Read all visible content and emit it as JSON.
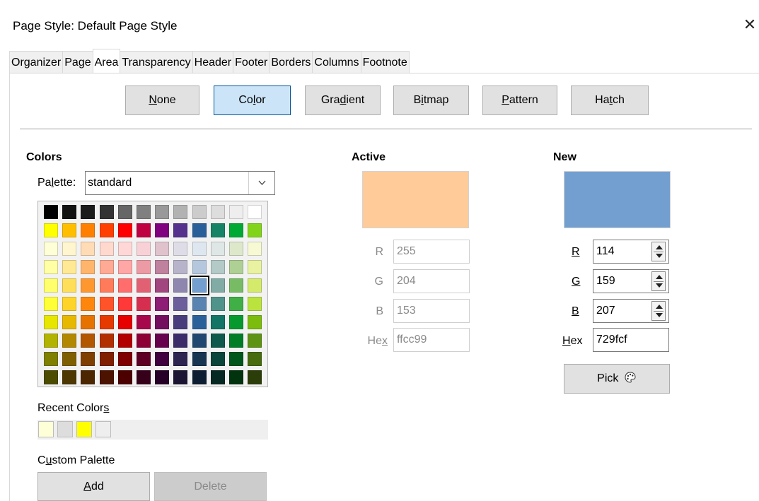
{
  "window": {
    "title": "Page Style: Default Page Style",
    "close_glyph": "✕"
  },
  "tabs": [
    {
      "label": "Organizer",
      "active": false
    },
    {
      "label": "Page",
      "active": false
    },
    {
      "label": "Area",
      "active": true
    },
    {
      "label": "Transparency",
      "active": false
    },
    {
      "label": "Header",
      "active": false
    },
    {
      "label": "Footer",
      "active": false
    },
    {
      "label": "Borders",
      "active": false
    },
    {
      "label": "Columns",
      "active": false
    },
    {
      "label": "Footnote",
      "active": false
    }
  ],
  "modes": {
    "none": {
      "pre": "",
      "key": "N",
      "post": "one"
    },
    "color": {
      "pre": "Co",
      "key": "l",
      "post": "or"
    },
    "gradient": {
      "pre": "Gra",
      "key": "d",
      "post": "ient"
    },
    "bitmap": {
      "pre": "B",
      "key": "i",
      "post": "tmap"
    },
    "pattern": {
      "pre": "",
      "key": "P",
      "post": "attern"
    },
    "hatch": {
      "pre": "Ha",
      "key": "t",
      "post": "ch"
    },
    "active": "color"
  },
  "colors": {
    "heading": "Colors",
    "palette_label": {
      "pre": "Pa",
      "key": "l",
      "post": "ette:"
    },
    "palette_value": "standard",
    "palette_chevron": "⌄",
    "grid": [
      [
        "#000000",
        "#111111",
        "#1c1c1c",
        "#333333",
        "#666666",
        "#808080",
        "#999999",
        "#b2b2b2",
        "#cccccc",
        "#dddddd",
        "#eeeeee",
        "#ffffff"
      ],
      [
        "#ffff00",
        "#ffbf00",
        "#ff8000",
        "#ff4000",
        "#ff0000",
        "#bf0041",
        "#800080",
        "#55308d",
        "#2a6099",
        "#158466",
        "#00a933",
        "#81d41a"
      ],
      [
        "#ffffd7",
        "#fff5ce",
        "#ffdbb6",
        "#ffd8ce",
        "#ffd7d7",
        "#f7d1d5",
        "#e0c2cd",
        "#dedce6",
        "#dee6ef",
        "#dee7e5",
        "#dde8cb",
        "#f6f9d4"
      ],
      [
        "#ffffa6",
        "#ffe994",
        "#ffb66c",
        "#ffaa95",
        "#ffa6a6",
        "#ec9ba4",
        "#bf819e",
        "#b7b3ca",
        "#b4c7dc",
        "#b3cac7",
        "#afd095",
        "#e8f2a1"
      ],
      [
        "#ffff6d",
        "#ffde59",
        "#ff972f",
        "#ff7b59",
        "#ff6d6d",
        "#e16173",
        "#a1467e",
        "#8e86ae",
        "#729fcf",
        "#81aca6",
        "#77bc65",
        "#d4ea6b"
      ],
      [
        "#ffff38",
        "#ffd428",
        "#ff860d",
        "#ff5429",
        "#ff3838",
        "#d62e4e",
        "#8d1d75",
        "#6b5e9b",
        "#5983b0",
        "#50938a",
        "#3faf46",
        "#bbe33d"
      ],
      [
        "#e6e600",
        "#e6b800",
        "#e67300",
        "#e63900",
        "#e60000",
        "#a7074b",
        "#730e5f",
        "#483c7c",
        "#2a6099",
        "#127566",
        "#069a2e",
        "#7bbc0d"
      ],
      [
        "#b2b200",
        "#b28800",
        "#b25600",
        "#b22f00",
        "#b20000",
        "#8c0036",
        "#66004d",
        "#3b2b68",
        "#1f4770",
        "#0e594c",
        "#017d26",
        "#5e9213"
      ],
      [
        "#7f7f00",
        "#7f6000",
        "#7f3f00",
        "#7f1f00",
        "#7f0000",
        "#5e0024",
        "#400040",
        "#2d2452",
        "#173451",
        "#0a453b",
        "#00561b",
        "#476b0d"
      ],
      [
        "#4c4c00",
        "#4c3800",
        "#4c2600",
        "#4c1300",
        "#4c0000",
        "#36001a",
        "#260026",
        "#1b1533",
        "#0d1e33",
        "#062923",
        "#00330e",
        "#2b3d08"
      ]
    ],
    "selected": [
      4,
      8
    ],
    "recent_label": {
      "pre": "Recent Color",
      "key": "s",
      "post": ""
    },
    "recent": [
      "#ffffd7",
      "#dddddd",
      "#ffff00",
      "#eeeeee"
    ],
    "custom_label": {
      "pre": "C",
      "key": "u",
      "post": "stom Palette"
    },
    "add": {
      "pre": "",
      "key": "A",
      "post": "dd"
    },
    "delete": "Delete"
  },
  "active": {
    "heading": "Active",
    "color": "#ffcc99",
    "r_label": "R",
    "g_label": "G",
    "b_label": "B",
    "hex_label": {
      "pre": "He",
      "key": "x",
      "post": ""
    },
    "r": "255",
    "g": "204",
    "b": "153",
    "hex": "ffcc99"
  },
  "new": {
    "heading": "New",
    "color": "#729fcf",
    "r_label": {
      "pre": "",
      "key": "R",
      "post": ""
    },
    "g_label": {
      "pre": "",
      "key": "G",
      "post": ""
    },
    "b_label": {
      "pre": "",
      "key": "B",
      "post": ""
    },
    "hex_label": {
      "pre": "",
      "key": "H",
      "post": "ex"
    },
    "r": "114",
    "g": "159",
    "b": "207",
    "hex": "729fcf",
    "pick": "Pick",
    "pick_icon": "palette-icon"
  }
}
